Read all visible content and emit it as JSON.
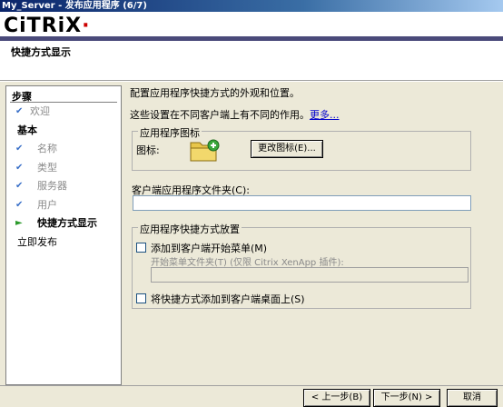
{
  "window": {
    "title": "My_Server - 发布应用程序 (6/7)"
  },
  "header": {
    "logo_text": "CiTRiX",
    "page_heading": "快捷方式显示"
  },
  "nav": {
    "title": "步骤",
    "items": [
      {
        "label": "欢迎",
        "state": "done"
      },
      {
        "label": "基本",
        "state": "section"
      },
      {
        "label": "名称",
        "state": "done"
      },
      {
        "label": "类型",
        "state": "done"
      },
      {
        "label": "服务器",
        "state": "done"
      },
      {
        "label": "用户",
        "state": "done"
      },
      {
        "label": "快捷方式显示",
        "state": "current"
      },
      {
        "label": "立即发布",
        "state": "section"
      }
    ]
  },
  "main": {
    "intro": "配置应用程序快捷方式的外观和位置。",
    "note": "这些设置在不同客户端上有不同的作用。",
    "more_link": "更多...",
    "icon_group": {
      "legend": "应用程序图标",
      "icon_label": "图标:",
      "change_button": "更改图标(E)..."
    },
    "folder_label": "客户端应用程序文件夹(C):",
    "folder_value": "",
    "placement_group": {
      "legend": "应用程序快捷方式放置",
      "start_menu_label": "添加到客户端开始菜单(M)",
      "start_menu_checked": false,
      "start_menu_folder_label": "开始菜单文件夹(T) (仅限 Citrix XenApp 插件):",
      "start_menu_folder_value": "",
      "desktop_label": "将快捷方式添加到客户端桌面上(S)",
      "desktop_checked": false
    }
  },
  "footer": {
    "back_button": "< 上一步(B)",
    "next_button": "下一步(N) >",
    "cancel_button": "取消"
  },
  "colors": {
    "title_bar": "#0a246a",
    "check": "#3a70c8",
    "current_arrow": "#2a9a2a",
    "link": "#0000cc"
  }
}
